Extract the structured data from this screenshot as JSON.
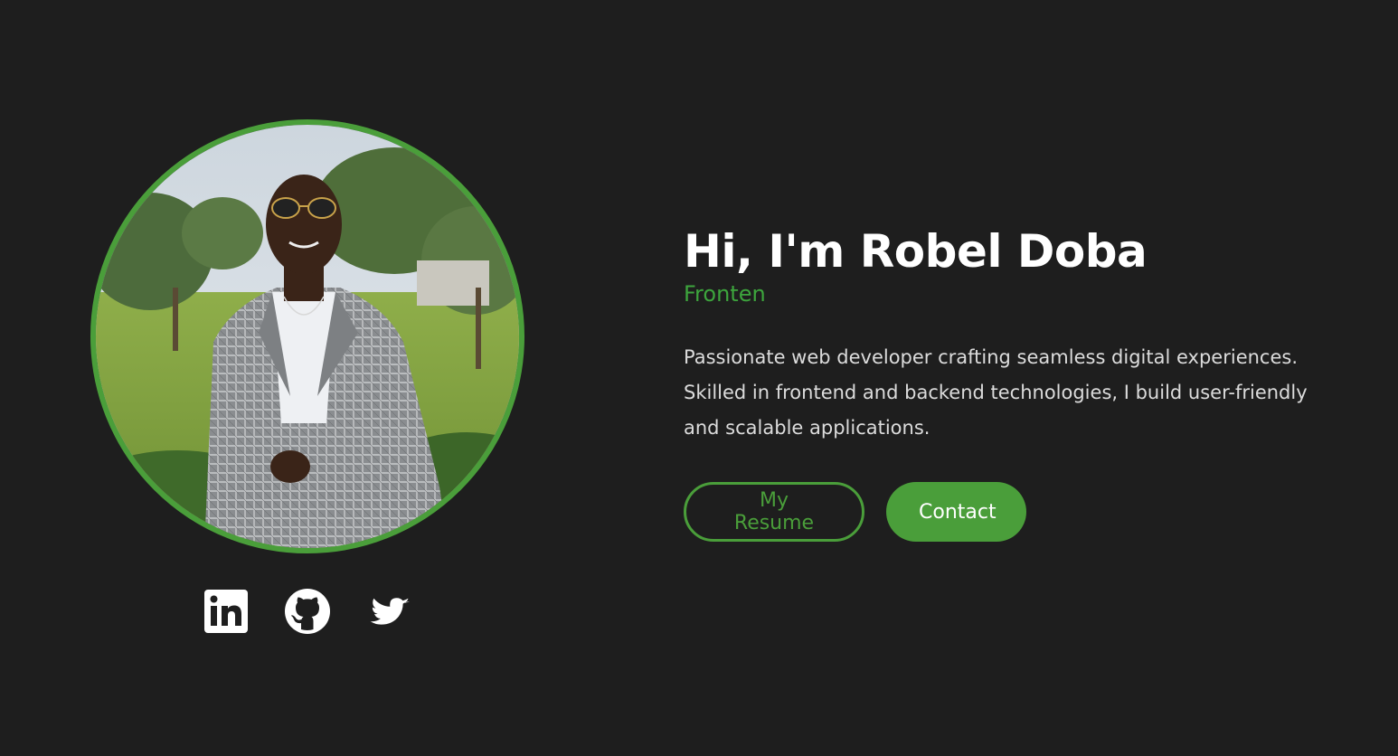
{
  "hero": {
    "title": "Hi, I'm Robel Doba",
    "role": "Fronten",
    "bio": "Passionate web developer crafting seamless digital experiences. Skilled in frontend and backend technologies, I build user-friendly and scalable applications.",
    "resume_label": "My Resume",
    "contact_label": "Contact"
  },
  "socials": [
    {
      "icon": "linkedin-icon"
    },
    {
      "icon": "github-icon"
    },
    {
      "icon": "twitter-icon"
    }
  ],
  "colors": {
    "background": "#1e1e1e",
    "accent": "#4a9e3a",
    "role_text": "#3da53d",
    "title_text": "#ffffff",
    "body_text": "#dcdcdc"
  }
}
